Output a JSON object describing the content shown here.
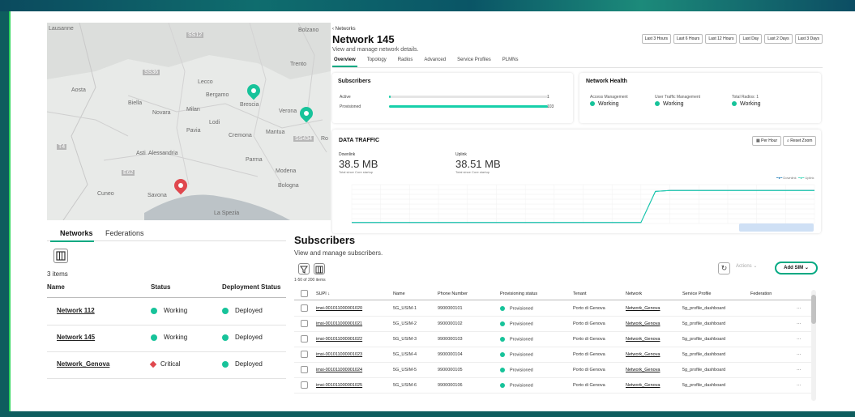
{
  "map": {
    "labels": [
      "Lausanne",
      "Bolzano",
      "Trento",
      "Aosta",
      "Biella",
      "Novara",
      "Milan",
      "Bergamo",
      "Brescia",
      "Verona",
      "Lecco",
      "Pavia",
      "Lodi",
      "Cremona",
      "Mantua",
      "Asti",
      "Alessandria",
      "Parma",
      "Modena",
      "Bologna",
      "Cuneo",
      "Savona",
      "La Spezia",
      "Ferrara",
      "Ro"
    ],
    "road_labels": [
      "SS36",
      "SS12",
      "E43",
      "SS434",
      "A4",
      "E62",
      "T4"
    ]
  },
  "network": {
    "back_label": "Networks",
    "title": "Network 145",
    "subtitle": "View and manage network details.",
    "time_ranges": [
      "Last 3 Hours",
      "Last 6 Hours",
      "Last 12 Hours",
      "Last Day",
      "Last 2 Days",
      "Last 3 Days"
    ],
    "tabs": [
      "Overview",
      "Topology",
      "Radios",
      "Advanced",
      "Service Profiles",
      "PLMNs"
    ],
    "active_tab": "Overview",
    "subscribers_card": {
      "title": "Subscribers",
      "active_label": "Active",
      "active_value": "1",
      "active_fraction": 0.01,
      "provisioned_label": "Provisioned",
      "provisioned_value": "103",
      "provisioned_fraction": 1.0
    },
    "health_card": {
      "title": "Network Health",
      "items": [
        {
          "label": "Access Management",
          "value": "Working"
        },
        {
          "label": "User Traffic Management",
          "value": "Working"
        },
        {
          "label": "Total Radios: 1",
          "value": "Working"
        }
      ]
    },
    "traffic_card": {
      "title": "DATA TRAFFIC",
      "per_hour_label": "Per Hour",
      "reset_zoom_label": "Reset Zoom",
      "downlink_label": "Downlink",
      "downlink_value": "38.5 MB",
      "downlink_note": "Total since Core startup",
      "uplink_label": "Uplink",
      "uplink_value": "38.51 MB",
      "uplink_note": "Total since Core startup",
      "legend": [
        "Downlink",
        "Uplink"
      ]
    }
  },
  "chart_data": {
    "type": "line",
    "series": [
      {
        "name": "Downlink",
        "values": [
          0.1,
          0.1,
          0.1,
          0.1,
          0.1,
          0.1,
          0.1,
          0.1,
          0.1,
          0.1,
          0.1,
          0.1,
          0.1,
          0.1,
          0.1,
          0.1,
          0.1,
          0.1,
          0.1,
          0.1,
          0.1,
          3.3,
          3.4,
          3.4,
          3.4,
          3.4,
          3.4,
          3.4,
          3.4,
          3.4,
          3.4,
          3.4,
          3.4
        ]
      },
      {
        "name": "Uplink",
        "values": [
          0.1,
          0.1,
          0.1,
          0.1,
          0.1,
          0.1,
          0.1,
          0.1,
          0.1,
          0.1,
          0.1,
          0.1,
          0.1,
          0.1,
          0.1,
          0.1,
          0.1,
          0.1,
          0.1,
          0.1,
          0.1,
          3.3,
          3.4,
          3.4,
          3.4,
          3.4,
          3.4,
          3.4,
          3.4,
          3.4,
          3.4,
          3.4,
          3.4
        ]
      }
    ],
    "ylim": [
      0,
      4
    ],
    "legend": "top-right",
    "grid": true
  },
  "left_panel": {
    "tabs": [
      "Networks",
      "Federations"
    ],
    "active_tab": "Networks",
    "items_count": "3 items",
    "columns": [
      "Name",
      "Status",
      "Deployment Status"
    ],
    "rows": [
      {
        "name": "Network 112",
        "status": "Working",
        "status_color": "#17c39a",
        "deployment": "Deployed"
      },
      {
        "name": "Network 145",
        "status": "Working",
        "status_color": "#17c39a",
        "deployment": "Deployed"
      },
      {
        "name": "Network_Genova",
        "status": "Critical",
        "status_color": "#e0484e",
        "deployment": "Deployed"
      }
    ]
  },
  "subscribers": {
    "title": "Subscribers",
    "subtitle": "View and manage subscribers.",
    "range_text": "1-50 of 200 items",
    "actions_label": "Actions",
    "add_sim_label": "Add SIM",
    "columns": [
      "SUPI",
      "Name",
      "Phone Number",
      "Provisioning status",
      "Tenant",
      "Network",
      "Service Profile",
      "Federation"
    ],
    "rows": [
      {
        "supi": "imsi-001011000001020",
        "name": "5G_USIM-1",
        "phone": "9900000101",
        "status": "Provisioned",
        "tenant": "Porto di Genova",
        "network": "Network_Genova",
        "profile": "5g_profile_dashboard"
      },
      {
        "supi": "imsi-001011000001021",
        "name": "5G_USIM-2",
        "phone": "9900000102",
        "status": "Provisioned",
        "tenant": "Porto di Genova",
        "network": "Network_Genova",
        "profile": "5g_profile_dashboard"
      },
      {
        "supi": "imsi-001011000001022",
        "name": "5G_USIM-3",
        "phone": "9900000103",
        "status": "Provisioned",
        "tenant": "Porto di Genova",
        "network": "Network_Genova",
        "profile": "5g_profile_dashboard"
      },
      {
        "supi": "imsi-001011000001023",
        "name": "5G_USIM-4",
        "phone": "9900000104",
        "status": "Provisioned",
        "tenant": "Porto di Genova",
        "network": "Network_Genova",
        "profile": "5g_profile_dashboard"
      },
      {
        "supi": "imsi-001011000001024",
        "name": "5G_USIM-5",
        "phone": "9900000105",
        "status": "Provisioned",
        "tenant": "Porto di Genova",
        "network": "Network_Genova",
        "profile": "5g_profile_dashboard"
      },
      {
        "supi": "imsi-001011000001025",
        "name": "5G_USIM-6",
        "phone": "9900000106",
        "status": "Provisioned",
        "tenant": "Porto di Genova",
        "network": "Network_Genova",
        "profile": "5g_profile_dashboard"
      }
    ]
  }
}
